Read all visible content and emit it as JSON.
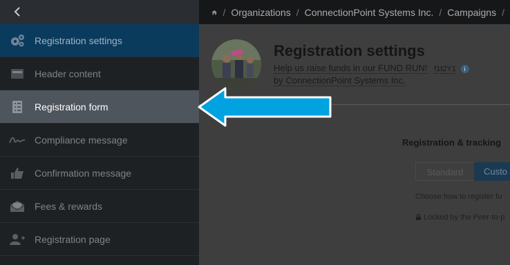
{
  "topbar": {
    "back_icon": "chevron-left-icon",
    "breadcrumbs": [
      {
        "label": "Organizations"
      },
      {
        "label": "ConnectionPoint Systems Inc."
      },
      {
        "label": "Campaigns"
      }
    ],
    "separator": "/"
  },
  "sidebar": {
    "items": [
      {
        "label": "Registration settings",
        "icon": "gears-icon",
        "state": "active"
      },
      {
        "label": "Header content",
        "icon": "header-icon"
      },
      {
        "label": "Registration form",
        "icon": "form-list-icon",
        "state": "highlighted"
      },
      {
        "label": "Compliance message",
        "icon": "signature-icon"
      },
      {
        "label": "Confirmation message",
        "icon": "thumbs-up-icon"
      },
      {
        "label": "Fees & rewards",
        "icon": "envelope-money-icon"
      },
      {
        "label": "Registration page",
        "icon": "add-user-icon"
      }
    ]
  },
  "main": {
    "title": "Registration settings",
    "subtitle": "Help us raise funds in our FUND RUN!",
    "campaign_code": "f1t2Y1",
    "byline": "by ConnectionPoint Systems Inc.",
    "section_title": "Registration & tracking",
    "segment": {
      "standard": "Standard",
      "custom": "Custo"
    },
    "help_text": "Choose how to register fu",
    "locked_text": "Locked by the Peer-to-p"
  },
  "colors": {
    "accent_arrow": "#00a3e0",
    "sidebar_active": "#0a3a5c",
    "sidebar_highlight": "#4e555d"
  }
}
